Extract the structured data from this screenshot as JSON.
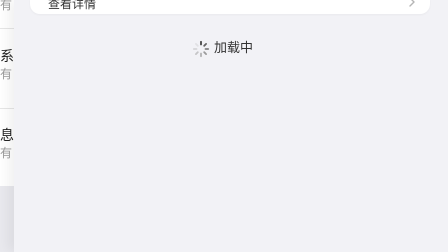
{
  "background_list": {
    "items": [
      {
        "title": "系",
        "subtitle": "有"
      },
      {
        "title": "息",
        "subtitle": "有"
      }
    ]
  },
  "detail_card": {
    "label": "查看详情",
    "chevron_icon": "chevron-right-icon"
  },
  "loading": {
    "text": "加载中",
    "icon": "spinner-icon"
  },
  "colors": {
    "page_bg": "#f2f2f6",
    "card_bg": "#ffffff",
    "text": "#333333",
    "muted": "#9a9a9a"
  }
}
